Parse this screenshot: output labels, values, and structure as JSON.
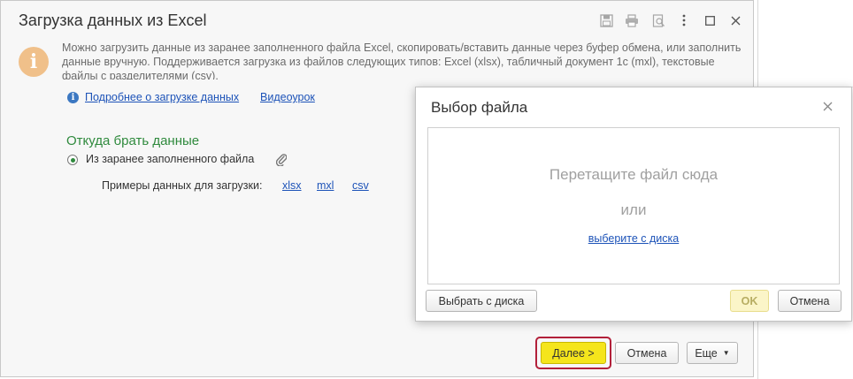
{
  "window": {
    "title": "Загрузка данных из Excel"
  },
  "info": {
    "text": "Можно загрузить данные из заранее заполненного файла Excel, скопировать/вставить данные через буфер обмена, или заполнить данные вручную. Поддерживается загрузка из файлов следующих типов: Excel (xlsx), табличный документ 1с (mxl), текстовые файлы с разделителями (csv).",
    "more_link": "Подробнее о загрузке данных",
    "video_link": "Видеоурок"
  },
  "source": {
    "section_title": "Откуда брать данные",
    "option_label": "Из заранее заполненного файла",
    "examples_label": "Примеры данных для загрузки:",
    "examples": [
      "xlsx",
      "mxl",
      "csv"
    ]
  },
  "footer": {
    "next_label": "Далее >",
    "cancel_label": "Отмена",
    "more_label": "Еще"
  },
  "dialog": {
    "title": "Выбор файла",
    "drop_text": "Перетащите файл сюда",
    "or_text": "или",
    "choose_link": "выберите с диска",
    "choose_button": "Выбрать с диска",
    "ok_label": "OK",
    "cancel_label": "Отмена"
  },
  "colors": {
    "accent_yellow": "#f5e51c",
    "section_green": "#2f8a3d",
    "link_blue": "#1d53b8",
    "focus_red": "#b2203a"
  }
}
